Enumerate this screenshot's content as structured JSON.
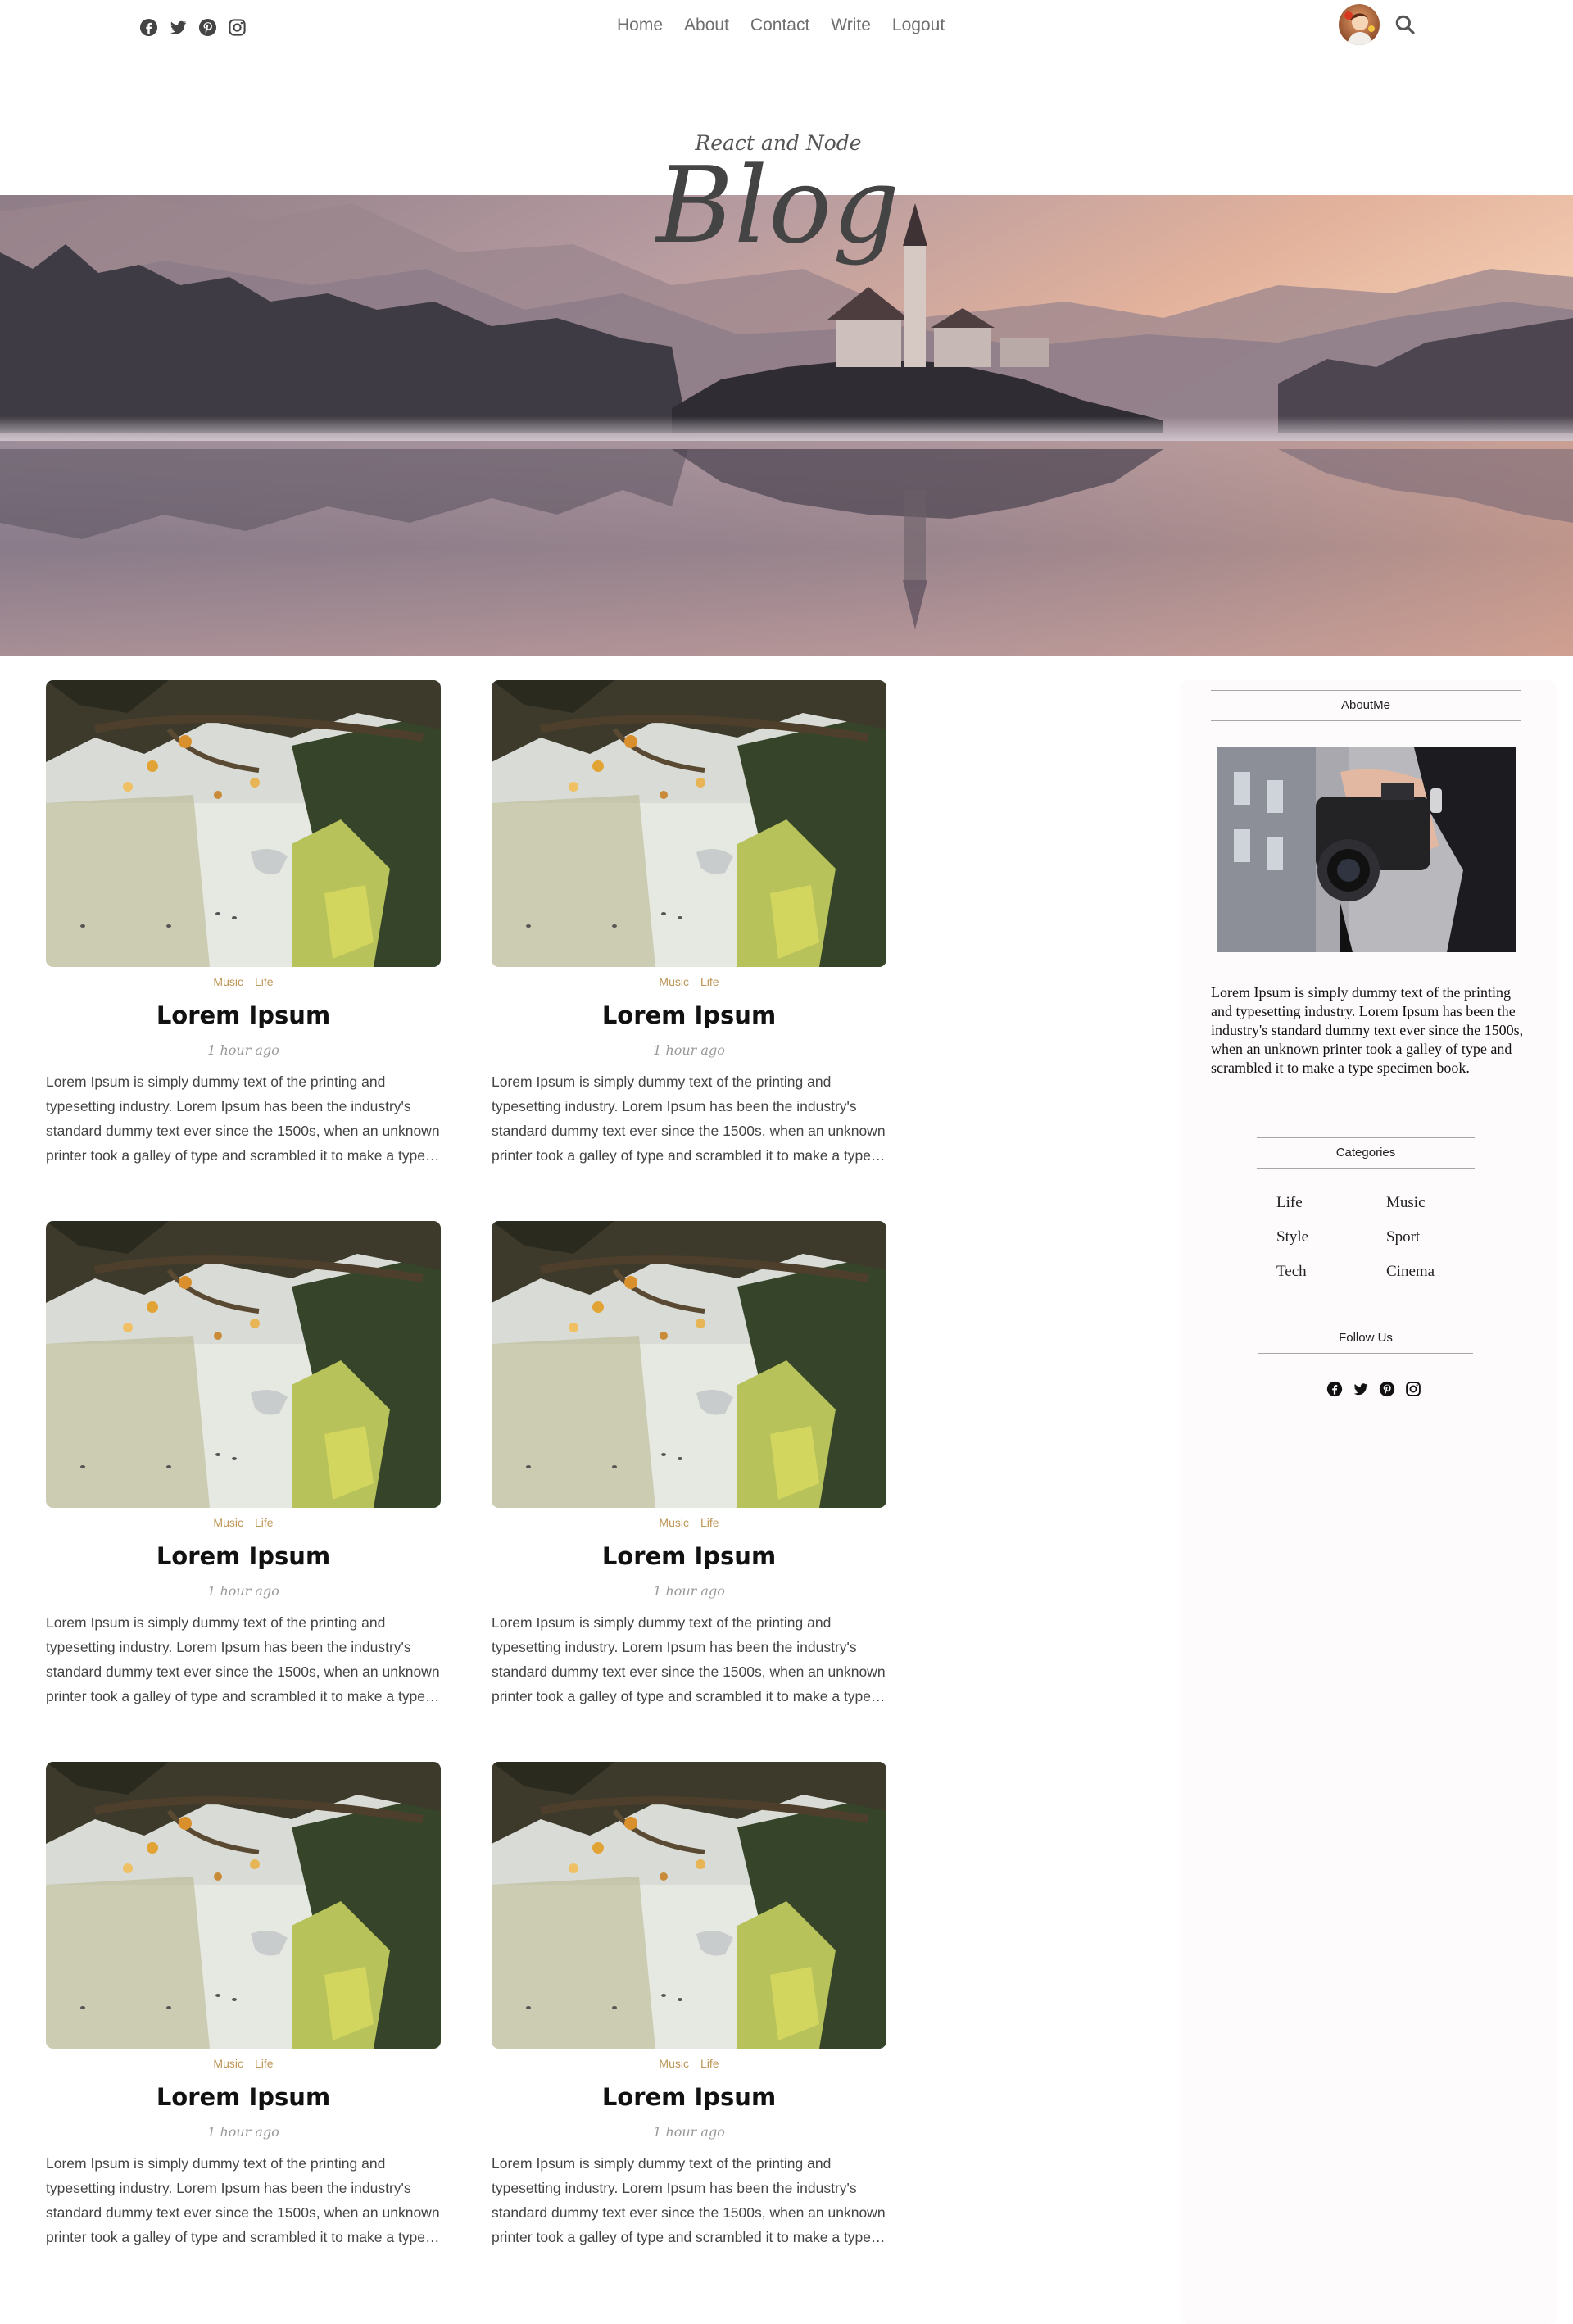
{
  "topbar": {
    "social_icons": [
      "facebook-icon",
      "twitter-icon",
      "pinterest-icon",
      "instagram-icon"
    ],
    "nav": [
      "Home",
      "About",
      "Contact",
      "Write",
      "Logout"
    ]
  },
  "header": {
    "subtitle": "React and Node",
    "title": "Blog"
  },
  "posts": [
    {
      "categories": [
        "Music",
        "Life"
      ],
      "title": "Lorem Ipsum",
      "date": "1 hour ago",
      "description": "Lorem Ipsum is simply dummy text of the printing and typesetting industry. Lorem Ipsum has been the industry's standard dummy text ever since the 1500s, when an unknown printer took a galley of type and scrambled it to make a type specimen book."
    },
    {
      "categories": [
        "Music",
        "Life"
      ],
      "title": "Lorem Ipsum",
      "date": "1 hour ago",
      "description": "Lorem Ipsum is simply dummy text of the printing and typesetting industry. Lorem Ipsum has been the industry's standard dummy text ever since the 1500s, when an unknown printer took a galley of type and scrambled it to make a type specimen book."
    },
    {
      "categories": [
        "Music",
        "Life"
      ],
      "title": "Lorem Ipsum",
      "date": "1 hour ago",
      "description": "Lorem Ipsum is simply dummy text of the printing and typesetting industry. Lorem Ipsum has been the industry's standard dummy text ever since the 1500s, when an unknown printer took a galley of type and scrambled it to make a type specimen book."
    },
    {
      "categories": [
        "Music",
        "Life"
      ],
      "title": "Lorem Ipsum",
      "date": "1 hour ago",
      "description": "Lorem Ipsum is simply dummy text of the printing and typesetting industry. Lorem Ipsum has been the industry's standard dummy text ever since the 1500s, when an unknown printer took a galley of type and scrambled it to make a type specimen book."
    },
    {
      "categories": [
        "Music",
        "Life"
      ],
      "title": "Lorem Ipsum",
      "date": "1 hour ago",
      "description": "Lorem Ipsum is simply dummy text of the printing and typesetting industry. Lorem Ipsum has been the industry's standard dummy text ever since the 1500s, when an unknown printer took a galley of type and scrambled it to make a type specimen book."
    },
    {
      "categories": [
        "Music",
        "Life"
      ],
      "title": "Lorem Ipsum",
      "date": "1 hour ago",
      "description": "Lorem Ipsum is simply dummy text of the printing and typesetting industry. Lorem Ipsum has been the industry's standard dummy text ever since the 1500s, when an unknown printer took a galley of type and scrambled it to make a type specimen book."
    }
  ],
  "sidebar": {
    "about_heading": "AboutMe",
    "about_text": "Lorem Ipsum is simply dummy text of the printing and typesetting industry. Lorem Ipsum has been the industry's standard dummy text ever since the 1500s, when an unknown printer took a galley of type and scrambled it to make a type specimen book.",
    "categories_heading": "Categories",
    "categories": [
      "Life",
      "Music",
      "Style",
      "Sport",
      "Tech",
      "Cinema"
    ],
    "follow_heading": "Follow Us",
    "social_icons": [
      "facebook-icon",
      "twitter-icon",
      "pinterest-icon",
      "instagram-icon"
    ]
  },
  "colors": {
    "accent": "#be9656",
    "nav_text": "#6f6f6f",
    "sidebar_bg": "#fdfbfb"
  }
}
